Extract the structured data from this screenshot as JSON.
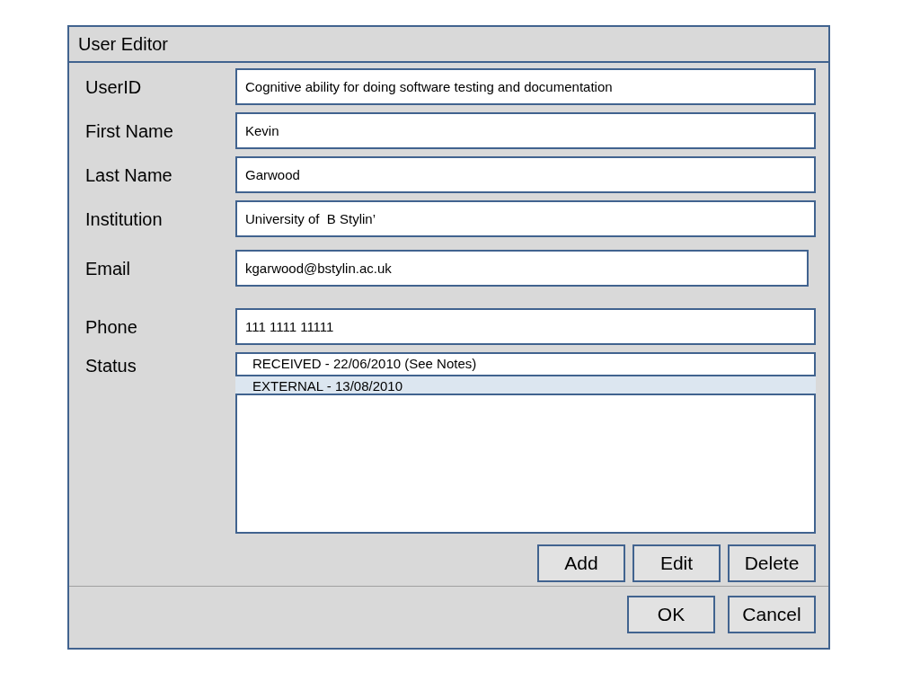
{
  "window": {
    "title": "User Editor"
  },
  "fields": [
    {
      "label": "UserID",
      "value": "Cognitive ability for doing software testing and documentation"
    },
    {
      "label": "First Name",
      "value": "Kevin"
    },
    {
      "label": "Last Name",
      "value": "Garwood"
    },
    {
      "label": "Institution",
      "value": "University of  B Stylin’"
    },
    {
      "label": "Email",
      "value": "kgarwood@bstylin.ac.uk"
    },
    {
      "label": "Phone",
      "value": "111 1111 11111"
    }
  ],
  "status": {
    "label": "Status",
    "items": [
      {
        "text": "RECEIVED  - 22/06/2010 (See Notes)",
        "selected": false
      },
      {
        "text": "EXTERNAL - 13/08/2010",
        "selected": true
      }
    ]
  },
  "list_buttons": [
    "Add",
    "Edit",
    "Delete"
  ],
  "dialog_buttons": [
    "OK",
    "Cancel"
  ]
}
